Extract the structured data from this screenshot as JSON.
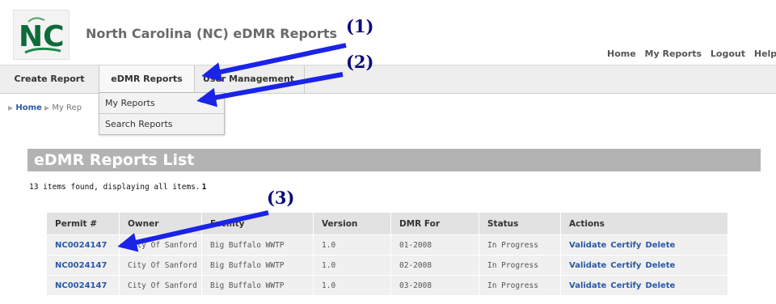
{
  "header": {
    "logo_text": "NC",
    "title": "North Carolina (NC) eDMR Reports",
    "links": [
      "Home",
      "My Reports",
      "Logout",
      "Help"
    ]
  },
  "tabs": [
    {
      "label": "Create Report"
    },
    {
      "label": "eDMR Reports"
    },
    {
      "label": "User Management"
    }
  ],
  "dropdown": [
    "My Reports",
    "Search Reports"
  ],
  "breadcrumb": {
    "home": "Home",
    "current": "My Rep"
  },
  "list": {
    "title": "eDMR Reports List",
    "items_found": "13 items found, displaying all items.",
    "page": "1"
  },
  "table": {
    "columns": [
      "Permit #",
      "Owner",
      "Facility",
      "Version",
      "DMR For",
      "Status",
      "Actions"
    ],
    "rows": [
      {
        "permit": "NC0024147",
        "owner": "City Of Sanford",
        "facility": "Big Buffalo WWTP",
        "version": "1.0",
        "dmr_for": "01-2008",
        "status": "In Progress"
      },
      {
        "permit": "NC0024147",
        "owner": "City Of Sanford",
        "facility": "Big Buffalo WWTP",
        "version": "1.0",
        "dmr_for": "02-2008",
        "status": "In Progress"
      },
      {
        "permit": "NC0024147",
        "owner": "City Of Sanford",
        "facility": "Big Buffalo WWTP",
        "version": "1.0",
        "dmr_for": "03-2008",
        "status": "In Progress"
      }
    ],
    "actions": [
      "Validate",
      "Certify",
      "Delete"
    ]
  },
  "annotations": [
    "(1)",
    "(2)",
    "(3)"
  ],
  "colors": {
    "arrow": "#1a23e8",
    "link": "#2a59a8",
    "heading_bar": "#b3b3b3"
  }
}
